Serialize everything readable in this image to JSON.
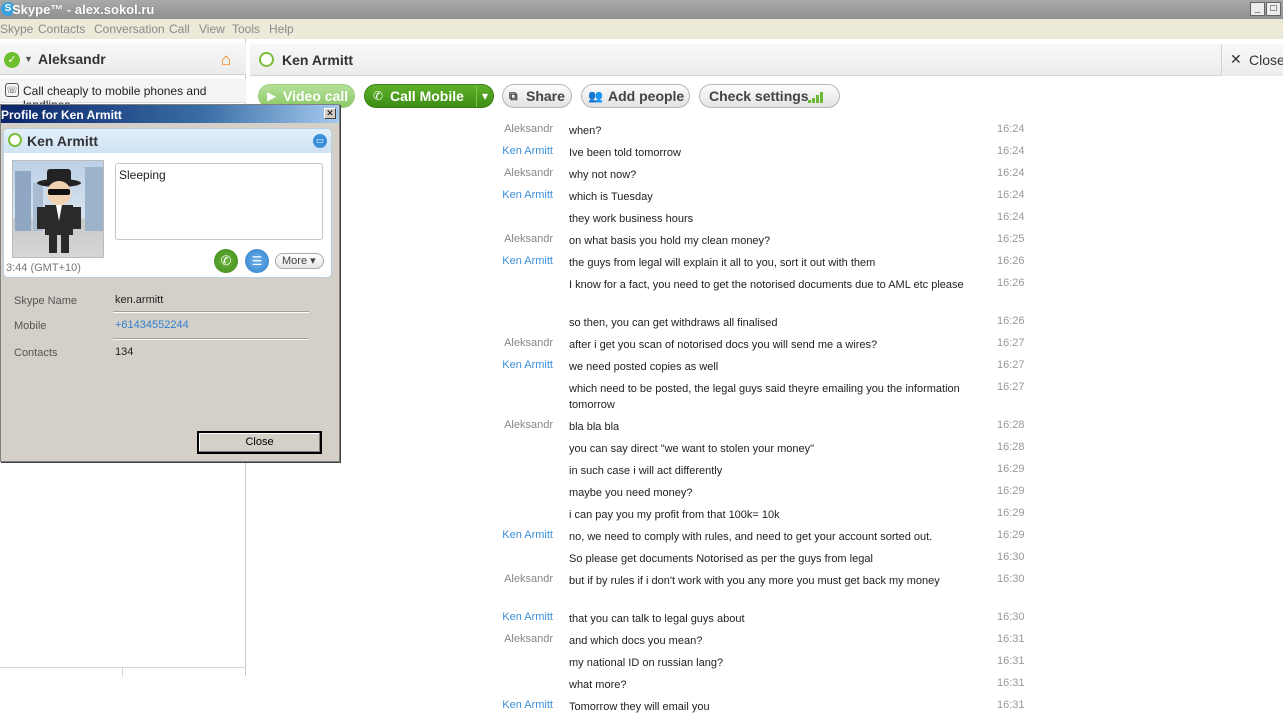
{
  "window": {
    "title": "Skype™ - alex.sokol.ru",
    "app_icon_glyph": "S",
    "minimize_glyph": "_",
    "maximize_glyph": "□"
  },
  "menu": [
    "Skype",
    "Contacts",
    "Conversation",
    "Call",
    "View",
    "Tools",
    "Help"
  ],
  "sidebar": {
    "user_name": "Aleksandr",
    "status_glyph": "✓",
    "caret_glyph": "▼",
    "home_glyph": "⌂",
    "promo_text": "Call cheaply to mobile phones and landlines",
    "promo_icon": "phone-icon",
    "promo_glyph": "☏"
  },
  "profile": {
    "window_title": "Profile for Ken Armitt",
    "close_glyph": "✕",
    "name": "Ken Armitt",
    "video_glyph": "▭",
    "mood": "Sleeping",
    "local_time": "3:44 (GMT+10)",
    "call_glyph": "✆",
    "chat_glyph": "☰",
    "more_label": "More ▾",
    "fields": [
      {
        "label": "Skype Name",
        "value": "ken.armitt"
      },
      {
        "label": "Mobile",
        "value": "+61434552244"
      },
      {
        "label": "Contacts",
        "value": "134"
      }
    ],
    "close_button": "Close"
  },
  "conversation": {
    "contact_name": "Ken Armitt",
    "close_label": "Close",
    "close_glyph": "✕"
  },
  "toolbar": {
    "video_call": "Video call",
    "video_glyph": "▶",
    "call_mobile": "Call Mobile",
    "call_glyph": "✆",
    "dropdown_glyph": "▾",
    "share": "Share",
    "share_glyph": "⧉",
    "add_people": "Add people",
    "add_people_glyph": "👥",
    "check_settings": "Check settings"
  },
  "colors": {
    "skype_blue": "#3b8fd9",
    "call_green": "#4e9f20",
    "home_orange": "#f07d00"
  },
  "messages": [
    {
      "sender": "Aleksandr",
      "text": "when?",
      "time": "16:24"
    },
    {
      "sender": "Ken Armitt",
      "text": "Ive been told tomorrow",
      "time": "16:24"
    },
    {
      "sender": "Aleksandr",
      "text": "why not now?",
      "time": "16:24"
    },
    {
      "sender": "Ken Armitt",
      "text": "which is Tuesday",
      "time": "16:24"
    },
    {
      "sender": "",
      "text": "they work business hours",
      "time": "16:24"
    },
    {
      "sender": "Aleksandr",
      "text": "on what basis you hold my clean money?",
      "time": "16:25"
    },
    {
      "sender": "Ken Armitt",
      "text": "the guys from legal will explain it all to you, sort it out with them",
      "time": "16:26"
    },
    {
      "sender": "",
      "text": "I know for a fact, you need to get the notorised documents due to AML etc please",
      "time": "16:26"
    },
    {
      "sender": "",
      "text": "so then, you can get withdraws all finalised",
      "time": "16:26"
    },
    {
      "sender": "Aleksandr",
      "text": "after i get you scan of notorised docs you will send me a wires?",
      "time": "16:27"
    },
    {
      "sender": "Ken Armitt",
      "text": "we need posted copies as well",
      "time": "16:27"
    },
    {
      "sender": "",
      "text": "which need to be posted, the legal guys said theyre emailing you the information tomorrow",
      "time": "16:27"
    },
    {
      "sender": "Aleksandr",
      "text": "bla bla bla",
      "time": "16:28"
    },
    {
      "sender": "",
      "text": "you can say direct \"we want to stolen your money\"",
      "time": "16:28"
    },
    {
      "sender": "",
      "text": "in such case i will act differently",
      "time": "16:29"
    },
    {
      "sender": "",
      "text": "maybe you need money?",
      "time": "16:29"
    },
    {
      "sender": "",
      "text": "i can pay you my profit from that 100k= 10k",
      "time": "16:29"
    },
    {
      "sender": "Ken Armitt",
      "text": "no, we need to comply with rules, and need to get your account sorted out.",
      "time": "16:29"
    },
    {
      "sender": "",
      "text": "So please get documents Notorised as per the guys from legal",
      "time": "16:30"
    },
    {
      "sender": "Aleksandr",
      "text": "but if by rules if i don't work with you any more you must get back my money",
      "time": "16:30"
    },
    {
      "sender": "Ken Armitt",
      "text": "that you can talk to legal guys about",
      "time": "16:30"
    },
    {
      "sender": "Aleksandr",
      "text": "and which docs you mean?",
      "time": "16:31"
    },
    {
      "sender": "",
      "text": "my national ID on russian lang?",
      "time": "16:31"
    },
    {
      "sender": "",
      "text": "what more?",
      "time": "16:31"
    },
    {
      "sender": "Ken Armitt",
      "text": "Tomorrow they will email you",
      "time": "16:31"
    }
  ]
}
